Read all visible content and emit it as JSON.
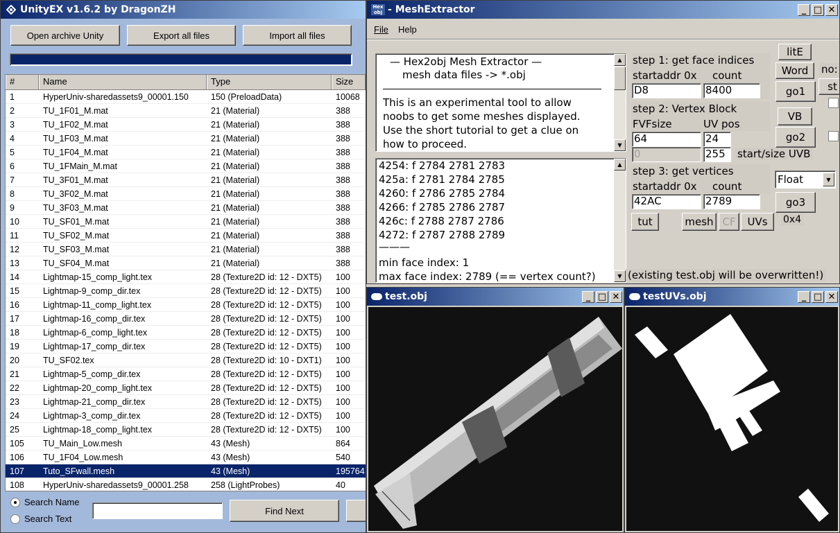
{
  "unityex": {
    "title": "UnityEX v1.6.2 by DragonZH",
    "open_label": "Open archive Unity",
    "export_label": "Export all files",
    "import_label": "Import all files",
    "progress": 1.0,
    "columns": [
      "#",
      "Name",
      "Type",
      "Size"
    ],
    "rows": [
      {
        "n": "1",
        "name": "HyperUniv-sharedassets9_00001.150",
        "type": "150 (PreloadData)",
        "size": "10068"
      },
      {
        "n": "2",
        "name": "TU_1F01_M.mat",
        "type": "21 (Material)",
        "size": "388"
      },
      {
        "n": "3",
        "name": "TU_1F02_M.mat",
        "type": "21 (Material)",
        "size": "388"
      },
      {
        "n": "4",
        "name": "TU_1F03_M.mat",
        "type": "21 (Material)",
        "size": "388"
      },
      {
        "n": "5",
        "name": "TU_1F04_M.mat",
        "type": "21 (Material)",
        "size": "388"
      },
      {
        "n": "6",
        "name": "TU_1FMain_M.mat",
        "type": "21 (Material)",
        "size": "388"
      },
      {
        "n": "7",
        "name": "TU_3F01_M.mat",
        "type": "21 (Material)",
        "size": "388"
      },
      {
        "n": "8",
        "name": "TU_3F02_M.mat",
        "type": "21 (Material)",
        "size": "388"
      },
      {
        "n": "9",
        "name": "TU_3F03_M.mat",
        "type": "21 (Material)",
        "size": "388"
      },
      {
        "n": "10",
        "name": "TU_SF01_M.mat",
        "type": "21 (Material)",
        "size": "388"
      },
      {
        "n": "11",
        "name": "TU_SF02_M.mat",
        "type": "21 (Material)",
        "size": "388"
      },
      {
        "n": "12",
        "name": "TU_SF03_M.mat",
        "type": "21 (Material)",
        "size": "388"
      },
      {
        "n": "13",
        "name": "TU_SF04_M.mat",
        "type": "21 (Material)",
        "size": "388"
      },
      {
        "n": "14",
        "name": "Lightmap-15_comp_light.tex",
        "type": "28 (Texture2D id: 12 - DXT5)",
        "size": "100"
      },
      {
        "n": "15",
        "name": "Lightmap-9_comp_dir.tex",
        "type": "28 (Texture2D id: 12 - DXT5)",
        "size": "100"
      },
      {
        "n": "16",
        "name": "Lightmap-11_comp_light.tex",
        "type": "28 (Texture2D id: 12 - DXT5)",
        "size": "100"
      },
      {
        "n": "17",
        "name": "Lightmap-16_comp_dir.tex",
        "type": "28 (Texture2D id: 12 - DXT5)",
        "size": "100"
      },
      {
        "n": "18",
        "name": "Lightmap-6_comp_light.tex",
        "type": "28 (Texture2D id: 12 - DXT5)",
        "size": "100"
      },
      {
        "n": "19",
        "name": "Lightmap-17_comp_dir.tex",
        "type": "28 (Texture2D id: 12 - DXT5)",
        "size": "100"
      },
      {
        "n": "20",
        "name": "TU_SF02.tex",
        "type": "28 (Texture2D id: 10 - DXT1)",
        "size": "100"
      },
      {
        "n": "21",
        "name": "Lightmap-5_comp_dir.tex",
        "type": "28 (Texture2D id: 12 - DXT5)",
        "size": "100"
      },
      {
        "n": "22",
        "name": "Lightmap-20_comp_light.tex",
        "type": "28 (Texture2D id: 12 - DXT5)",
        "size": "100"
      },
      {
        "n": "23",
        "name": "Lightmap-21_comp_dir.tex",
        "type": "28 (Texture2D id: 12 - DXT5)",
        "size": "100"
      },
      {
        "n": "24",
        "name": "Lightmap-3_comp_dir.tex",
        "type": "28 (Texture2D id: 12 - DXT5)",
        "size": "100"
      },
      {
        "n": "25",
        "name": "Lightmap-18_comp_light.tex",
        "type": "28 (Texture2D id: 12 - DXT5)",
        "size": "100"
      },
      {
        "n": "105",
        "name": "TU_Main_Low.mesh",
        "type": "43 (Mesh)",
        "size": "864"
      },
      {
        "n": "106",
        "name": "TU_1F04_Low.mesh",
        "type": "43 (Mesh)",
        "size": "540"
      },
      {
        "n": "107",
        "name": "Tuto_SFwall.mesh",
        "type": "43 (Mesh)",
        "size": "195764"
      },
      {
        "n": "108",
        "name": "HyperUniv-sharedassets9_00001.258",
        "type": "258 (LightProbes)",
        "size": "40"
      }
    ],
    "selected_row": "107",
    "search_name_label": "Search Name",
    "search_text_label": "Search Text",
    "search_value": "",
    "find_next_label": "Find Next"
  },
  "mesh": {
    "title": "MeshExtractor",
    "icon_text": "Hex obj",
    "menu": [
      "File",
      "Help"
    ],
    "info_lines": [
      "—  Hex2obj Mesh Extractor  —",
      "mesh data files -> *.obj",
      "This is an experimental tool to allow",
      "noobs to get some meshes displayed.",
      "Use the short tutorial to get a clue on",
      "how to proceed."
    ],
    "log_lines": [
      "4254: f  2784 2781 2783",
      "425a: f  2781 2784 2785",
      "4260: f  2786 2785 2784",
      "4266: f  2785 2786 2787",
      "426c: f  2788 2787 2786",
      "4272: f  2787 2788 2789",
      "———",
      "min face index: 1",
      "max face index: 2789 (== vertex count?)"
    ],
    "step1": "step 1: get face indices",
    "startaddr_label": "startaddr 0x",
    "count_label": "count",
    "s1_addr": "D8",
    "s1_count": "8400",
    "go1": "go1",
    "lite": "litE",
    "word": "Word",
    "no_partial": "no:",
    "st_partial": "st",
    "step2": "step 2: Vertex Block",
    "fvf_label": "FVFsize",
    "uvpos_label": "UV pos",
    "fvf": "64",
    "uvpos": "24",
    "s2_zero": "0",
    "s2_255": "255",
    "startsize_label": "start/size UVB",
    "vb": "VB",
    "go2": "go2",
    "step3": "step 3: get vertices",
    "s3_addr": "42AC",
    "s3_count": "2789",
    "float": "Float",
    "go3": "go3",
    "tut": "tut",
    "mesh_btn": "mesh",
    "cf": "CF",
    "uvs": "UVs",
    "ox4": "0x4",
    "overwrite": "(existing test.obj will be overwritten!)"
  },
  "testobj": {
    "title": "test.obj"
  },
  "testuvs": {
    "title": "testUVs.obj"
  }
}
